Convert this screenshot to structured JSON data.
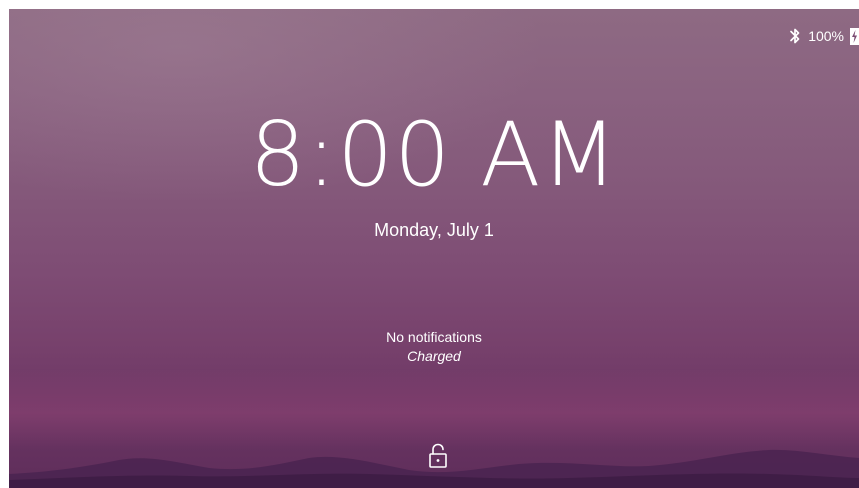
{
  "status": {
    "bluetooth_icon": "bluetooth-icon",
    "battery_percent_text": "100%",
    "battery_level": 1.0,
    "battery_icon": "battery-charging-icon"
  },
  "clock": {
    "time": "8:00 AM",
    "date": "Monday, July 1"
  },
  "notifications": {
    "summary": "No notifications",
    "battery_state": "Charged"
  },
  "unlock": {
    "icon": "unlock-icon"
  },
  "colors": {
    "text": "#ffffff",
    "wallpaper_top": "#8e6a83",
    "wallpaper_bottom": "#5e2d5a",
    "hills": "#3f1d46"
  }
}
